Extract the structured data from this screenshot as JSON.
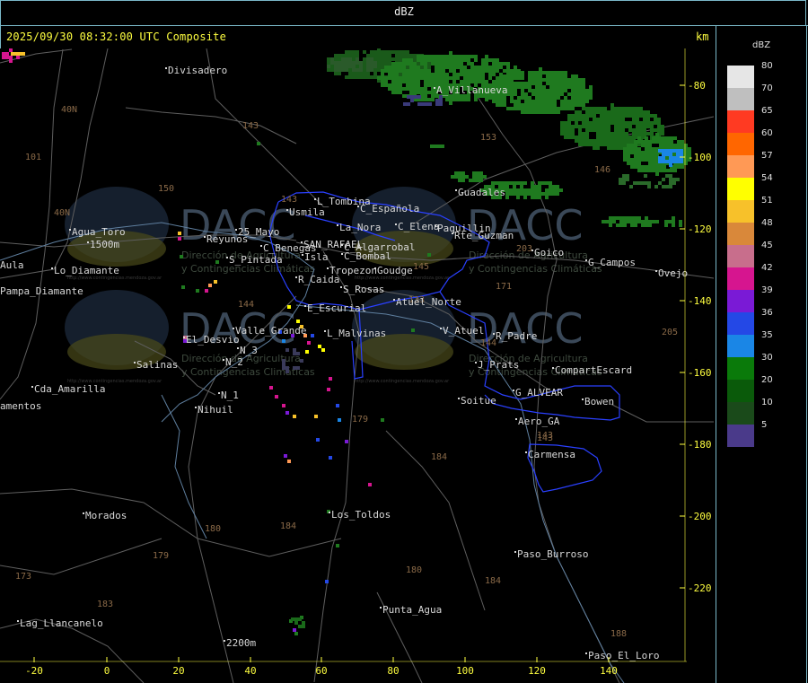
{
  "header": {
    "window_title": "dBZ",
    "timestamp": "2025/09/30 08:32:00 UTC Composite",
    "km_label": "km"
  },
  "axes": {
    "x_ticks": [
      "-20",
      "0",
      "20",
      "40",
      "60",
      "80",
      "100",
      "120",
      "140"
    ],
    "y_ticks": [
      "-80",
      "-100",
      "-120",
      "-140",
      "-160",
      "-180",
      "-200",
      "-220"
    ]
  },
  "legend": {
    "unit": "dBZ",
    "items": [
      {
        "label": "80",
        "color": "#e6e6e6"
      },
      {
        "label": "70",
        "color": "#bfbfbf"
      },
      {
        "label": "65",
        "color": "#ff3a22"
      },
      {
        "label": "60",
        "color": "#ff6600"
      },
      {
        "label": "57",
        "color": "#ff9955"
      },
      {
        "label": "54",
        "color": "#ffff00"
      },
      {
        "label": "51",
        "color": "#f7c12a"
      },
      {
        "label": "48",
        "color": "#d9883a"
      },
      {
        "label": "45",
        "color": "#c86e8c"
      },
      {
        "label": "42",
        "color": "#d6158f"
      },
      {
        "label": "39",
        "color": "#7a1ad6"
      },
      {
        "label": "36",
        "color": "#2448e6"
      },
      {
        "label": "35",
        "color": "#1a86e6"
      },
      {
        "label": "30",
        "color": "#0a7a0a"
      },
      {
        "label": "20",
        "color": "#0a5a0a"
      },
      {
        "label": "10",
        "color": "#1a4a1a"
      },
      {
        "label": "5",
        "color": "#4a3a8a"
      }
    ]
  },
  "map": {
    "place_labels": [
      {
        "name": "Divisadero"
      },
      {
        "name": "A_Villanueva"
      },
      {
        "name": "Guadales"
      },
      {
        "name": "Usmila"
      },
      {
        "name": "L_Tombina"
      },
      {
        "name": "C_Española"
      },
      {
        "name": "La_Nora"
      },
      {
        "name": "C_Elena"
      },
      {
        "name": "Paquillin"
      },
      {
        "name": "Rte_Guzman"
      },
      {
        "name": "Agua_Toro"
      },
      {
        "name": "Reyunos"
      },
      {
        "name": "25_Mayo"
      },
      {
        "name": "C_Benegas"
      },
      {
        "name": "SAN_RAFAEL"
      },
      {
        "name": "C_Algarrobal"
      },
      {
        "name": "C_Bombal"
      },
      {
        "name": "Goico"
      },
      {
        "name": "G_Campos"
      },
      {
        "name": "Ovejo"
      },
      {
        "name": "S_Pintada"
      },
      {
        "name": "Isla"
      },
      {
        "name": "Tropezon"
      },
      {
        "name": "Goudge"
      },
      {
        "name": "R_Caida"
      },
      {
        "name": "Pampa_Diamante"
      },
      {
        "name": "Aula"
      },
      {
        "name": "Lo_Diamante"
      },
      {
        "name": "S_Rosas"
      },
      {
        "name": "Atuel_Norte"
      },
      {
        "name": "E_Escurial"
      },
      {
        "name": "Valle_Grande"
      },
      {
        "name": "L_Malvinas"
      },
      {
        "name": "V_Atuel"
      },
      {
        "name": "R_Padre"
      },
      {
        "name": "El_Desvio"
      },
      {
        "name": "Salinas"
      },
      {
        "name": "N_2"
      },
      {
        "name": "N_3"
      },
      {
        "name": "J_Prats"
      },
      {
        "name": "CompartEscard"
      },
      {
        "name": "Cda_Amarilla"
      },
      {
        "name": "N_1"
      },
      {
        "name": "Nihuil"
      },
      {
        "name": "amentos"
      },
      {
        "name": "Soitue"
      },
      {
        "name": "G_ALVEAR"
      },
      {
        "name": "Bowen"
      },
      {
        "name": "Aero_GA"
      },
      {
        "name": "Carmensa"
      },
      {
        "name": "Morados"
      },
      {
        "name": "Los_Toldos"
      },
      {
        "name": "Paso_Burroso"
      },
      {
        "name": "Lag_Llancanelo"
      },
      {
        "name": "Punta_Agua"
      },
      {
        "name": "Paso_El_Loro"
      },
      {
        "name": "1500m"
      },
      {
        "name": "2200m"
      }
    ],
    "route_labels": [
      "40N",
      "101",
      "143",
      "153",
      "146",
      "150",
      "143",
      "40N",
      "144",
      "203",
      "145",
      "171",
      "144",
      "205",
      "179",
      "184",
      "180",
      "184",
      "179",
      "180",
      "184",
      "183",
      "143",
      "143",
      "133",
      "188",
      "173"
    ],
    "watermark": {
      "name": "DACC",
      "line1": "Dirección de Agricultura",
      "line2": "y Contingencias Climáticas",
      "url": "http://www.contingencias.mendoza.gov.ar"
    }
  },
  "colors": {
    "frame": "#7ab8c8",
    "header_text": "#ffff40",
    "place_text": "#d8d8d8",
    "route_text": "#a07850",
    "road": "#6a6a6a",
    "boundary": "#2a3aff",
    "river": "#6a8aa8"
  }
}
